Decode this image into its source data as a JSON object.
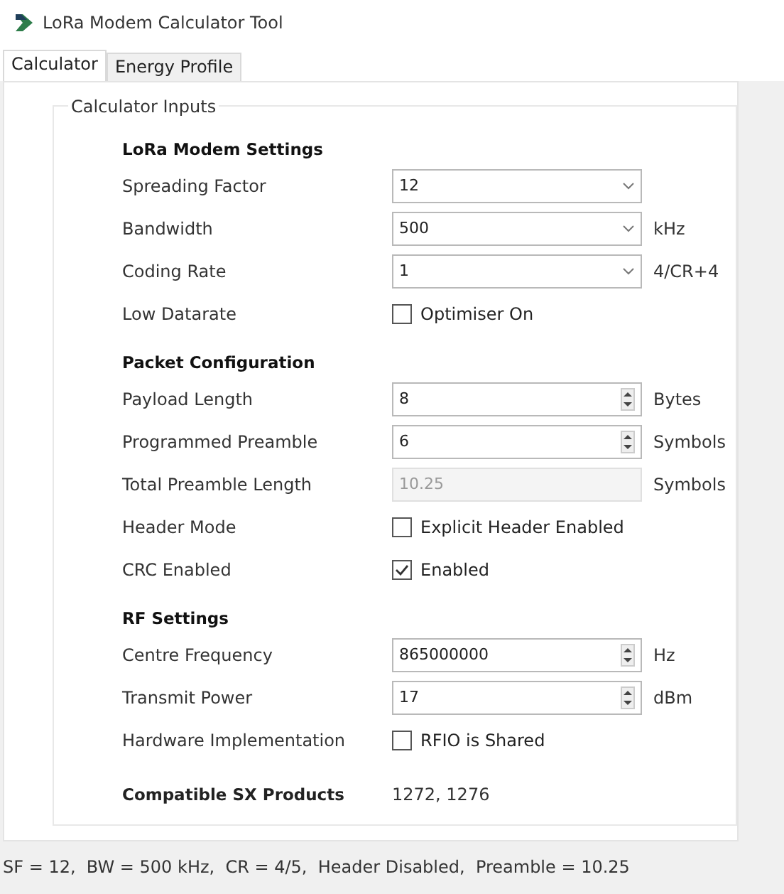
{
  "window": {
    "title": "LoRa Modem Calculator Tool"
  },
  "tabs": [
    {
      "label": "Calculator",
      "selected": true
    },
    {
      "label": "Energy Profile",
      "selected": false
    }
  ],
  "group": {
    "title": "Calculator Inputs"
  },
  "sections": [
    {
      "heading": "LoRa Modem Settings",
      "rows": [
        {
          "kind": "select",
          "label": "Spreading Factor",
          "value": "12"
        },
        {
          "kind": "select",
          "label": "Bandwidth",
          "value": "500",
          "unit": "kHz"
        },
        {
          "kind": "select",
          "label": "Coding Rate",
          "value": "1",
          "unit": "4/CR+4"
        },
        {
          "kind": "checkbox",
          "label": "Low Datarate",
          "text": "Optimiser On",
          "checked": false
        }
      ]
    },
    {
      "heading": "Packet Configuration",
      "rows": [
        {
          "kind": "spin",
          "label": "Payload Length",
          "value": "8",
          "unit": "Bytes"
        },
        {
          "kind": "spin",
          "label": "Programmed Preamble",
          "value": "6",
          "unit": "Symbols"
        },
        {
          "kind": "readonly",
          "label": "Total Preamble Length",
          "value": "10.25",
          "unit": "Symbols"
        },
        {
          "kind": "checkbox",
          "label": "Header Mode",
          "text": "Explicit Header Enabled",
          "checked": false
        },
        {
          "kind": "checkbox",
          "label": "CRC Enabled",
          "text": "Enabled",
          "checked": true
        }
      ]
    },
    {
      "heading": "RF Settings",
      "rows": [
        {
          "kind": "spin",
          "label": "Centre Frequency",
          "value": "865000000",
          "unit": "Hz"
        },
        {
          "kind": "spin",
          "label": "Transmit Power",
          "value": "17",
          "unit": "dBm"
        },
        {
          "kind": "checkbox",
          "label": "Hardware Implementation",
          "text": "RFIO is Shared",
          "checked": false
        }
      ]
    }
  ],
  "compatible": {
    "label": "Compatible SX Products",
    "value": "1272, 1276"
  },
  "status_bar": "SF = 12,  BW = 500 kHz,  CR = 4/5,  Header Disabled,  Preamble = 10.25"
}
